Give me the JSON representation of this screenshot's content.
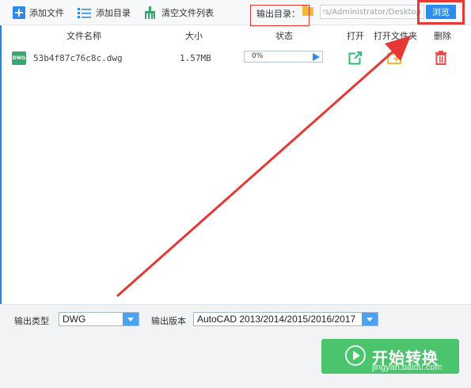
{
  "toolbar": {
    "add_file": "添加文件",
    "add_folder": "添加目录",
    "clear_list": "清空文件列表",
    "output_dir_label": "输出目录：",
    "output_path": "ers/Administrator/Desktop",
    "browse": "浏览"
  },
  "table": {
    "headers": {
      "name": "文件名称",
      "size": "大小",
      "status": "状态",
      "open": "打开",
      "open_folder": "打开文件夹",
      "delete": "删除"
    },
    "rows": [
      {
        "icon": "DWG",
        "name": "53b4f87c76c8c.dwg",
        "size": "1.57MB",
        "progress_text": "0%",
        "progress": 0
      }
    ]
  },
  "bottom": {
    "output_type_label": "输出类型",
    "output_type_value": "DWG",
    "output_version_label": "输出版本",
    "output_version_value": "AutoCAD 2013/2014/2015/2016/2017",
    "start_button": "开始转换",
    "watermark": "jingyan.baidu.com"
  },
  "colors": {
    "accent": "#2d8ceb",
    "start_green": "#4cc46e",
    "annotation_red": "#e53935",
    "folder_yellow": "#f5b93a",
    "open_green": "#2fbf71",
    "delete_red": "#e94b4b"
  }
}
